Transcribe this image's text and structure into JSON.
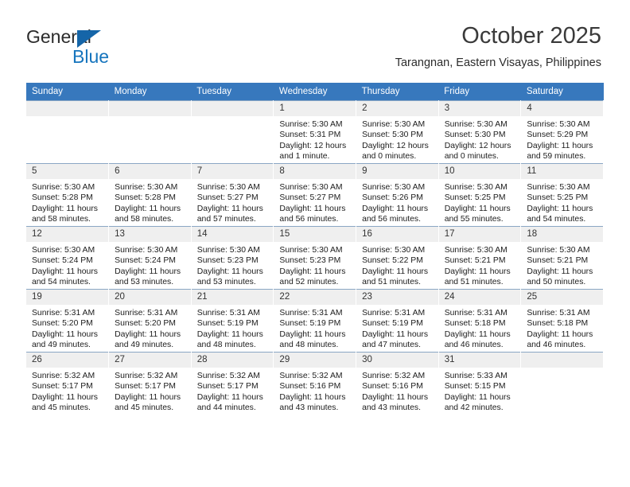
{
  "logo": {
    "word_top": "General",
    "word_bottom": "Blue",
    "triangle_color": "#1565a8",
    "blue_text_color": "#1574bd"
  },
  "header": {
    "title": "October 2025",
    "subtitle": "Tarangnan, Eastern Visayas, Philippines"
  },
  "theme": {
    "header_band": "#3778bd",
    "daynum_band": "#efefef",
    "row_border": "#8ba7c4"
  },
  "calendar": {
    "weekday_headers": [
      "Sunday",
      "Monday",
      "Tuesday",
      "Wednesday",
      "Thursday",
      "Friday",
      "Saturday"
    ],
    "weeks": [
      [
        {
          "day": "",
          "lines": [
            "",
            "",
            "",
            ""
          ]
        },
        {
          "day": "",
          "lines": [
            "",
            "",
            "",
            ""
          ]
        },
        {
          "day": "",
          "lines": [
            "",
            "",
            "",
            ""
          ]
        },
        {
          "day": "1",
          "lines": [
            "Sunrise: 5:30 AM",
            "Sunset: 5:31 PM",
            "Daylight: 12 hours",
            "and 1 minute."
          ]
        },
        {
          "day": "2",
          "lines": [
            "Sunrise: 5:30 AM",
            "Sunset: 5:30 PM",
            "Daylight: 12 hours",
            "and 0 minutes."
          ]
        },
        {
          "day": "3",
          "lines": [
            "Sunrise: 5:30 AM",
            "Sunset: 5:30 PM",
            "Daylight: 12 hours",
            "and 0 minutes."
          ]
        },
        {
          "day": "4",
          "lines": [
            "Sunrise: 5:30 AM",
            "Sunset: 5:29 PM",
            "Daylight: 11 hours",
            "and 59 minutes."
          ]
        }
      ],
      [
        {
          "day": "5",
          "lines": [
            "Sunrise: 5:30 AM",
            "Sunset: 5:28 PM",
            "Daylight: 11 hours",
            "and 58 minutes."
          ]
        },
        {
          "day": "6",
          "lines": [
            "Sunrise: 5:30 AM",
            "Sunset: 5:28 PM",
            "Daylight: 11 hours",
            "and 58 minutes."
          ]
        },
        {
          "day": "7",
          "lines": [
            "Sunrise: 5:30 AM",
            "Sunset: 5:27 PM",
            "Daylight: 11 hours",
            "and 57 minutes."
          ]
        },
        {
          "day": "8",
          "lines": [
            "Sunrise: 5:30 AM",
            "Sunset: 5:27 PM",
            "Daylight: 11 hours",
            "and 56 minutes."
          ]
        },
        {
          "day": "9",
          "lines": [
            "Sunrise: 5:30 AM",
            "Sunset: 5:26 PM",
            "Daylight: 11 hours",
            "and 56 minutes."
          ]
        },
        {
          "day": "10",
          "lines": [
            "Sunrise: 5:30 AM",
            "Sunset: 5:25 PM",
            "Daylight: 11 hours",
            "and 55 minutes."
          ]
        },
        {
          "day": "11",
          "lines": [
            "Sunrise: 5:30 AM",
            "Sunset: 5:25 PM",
            "Daylight: 11 hours",
            "and 54 minutes."
          ]
        }
      ],
      [
        {
          "day": "12",
          "lines": [
            "Sunrise: 5:30 AM",
            "Sunset: 5:24 PM",
            "Daylight: 11 hours",
            "and 54 minutes."
          ]
        },
        {
          "day": "13",
          "lines": [
            "Sunrise: 5:30 AM",
            "Sunset: 5:24 PM",
            "Daylight: 11 hours",
            "and 53 minutes."
          ]
        },
        {
          "day": "14",
          "lines": [
            "Sunrise: 5:30 AM",
            "Sunset: 5:23 PM",
            "Daylight: 11 hours",
            "and 53 minutes."
          ]
        },
        {
          "day": "15",
          "lines": [
            "Sunrise: 5:30 AM",
            "Sunset: 5:23 PM",
            "Daylight: 11 hours",
            "and 52 minutes."
          ]
        },
        {
          "day": "16",
          "lines": [
            "Sunrise: 5:30 AM",
            "Sunset: 5:22 PM",
            "Daylight: 11 hours",
            "and 51 minutes."
          ]
        },
        {
          "day": "17",
          "lines": [
            "Sunrise: 5:30 AM",
            "Sunset: 5:21 PM",
            "Daylight: 11 hours",
            "and 51 minutes."
          ]
        },
        {
          "day": "18",
          "lines": [
            "Sunrise: 5:30 AM",
            "Sunset: 5:21 PM",
            "Daylight: 11 hours",
            "and 50 minutes."
          ]
        }
      ],
      [
        {
          "day": "19",
          "lines": [
            "Sunrise: 5:31 AM",
            "Sunset: 5:20 PM",
            "Daylight: 11 hours",
            "and 49 minutes."
          ]
        },
        {
          "day": "20",
          "lines": [
            "Sunrise: 5:31 AM",
            "Sunset: 5:20 PM",
            "Daylight: 11 hours",
            "and 49 minutes."
          ]
        },
        {
          "day": "21",
          "lines": [
            "Sunrise: 5:31 AM",
            "Sunset: 5:19 PM",
            "Daylight: 11 hours",
            "and 48 minutes."
          ]
        },
        {
          "day": "22",
          "lines": [
            "Sunrise: 5:31 AM",
            "Sunset: 5:19 PM",
            "Daylight: 11 hours",
            "and 48 minutes."
          ]
        },
        {
          "day": "23",
          "lines": [
            "Sunrise: 5:31 AM",
            "Sunset: 5:19 PM",
            "Daylight: 11 hours",
            "and 47 minutes."
          ]
        },
        {
          "day": "24",
          "lines": [
            "Sunrise: 5:31 AM",
            "Sunset: 5:18 PM",
            "Daylight: 11 hours",
            "and 46 minutes."
          ]
        },
        {
          "day": "25",
          "lines": [
            "Sunrise: 5:31 AM",
            "Sunset: 5:18 PM",
            "Daylight: 11 hours",
            "and 46 minutes."
          ]
        }
      ],
      [
        {
          "day": "26",
          "lines": [
            "Sunrise: 5:32 AM",
            "Sunset: 5:17 PM",
            "Daylight: 11 hours",
            "and 45 minutes."
          ]
        },
        {
          "day": "27",
          "lines": [
            "Sunrise: 5:32 AM",
            "Sunset: 5:17 PM",
            "Daylight: 11 hours",
            "and 45 minutes."
          ]
        },
        {
          "day": "28",
          "lines": [
            "Sunrise: 5:32 AM",
            "Sunset: 5:17 PM",
            "Daylight: 11 hours",
            "and 44 minutes."
          ]
        },
        {
          "day": "29",
          "lines": [
            "Sunrise: 5:32 AM",
            "Sunset: 5:16 PM",
            "Daylight: 11 hours",
            "and 43 minutes."
          ]
        },
        {
          "day": "30",
          "lines": [
            "Sunrise: 5:32 AM",
            "Sunset: 5:16 PM",
            "Daylight: 11 hours",
            "and 43 minutes."
          ]
        },
        {
          "day": "31",
          "lines": [
            "Sunrise: 5:33 AM",
            "Sunset: 5:15 PM",
            "Daylight: 11 hours",
            "and 42 minutes."
          ]
        },
        {
          "day": "",
          "lines": [
            "",
            "",
            "",
            ""
          ]
        }
      ]
    ]
  }
}
